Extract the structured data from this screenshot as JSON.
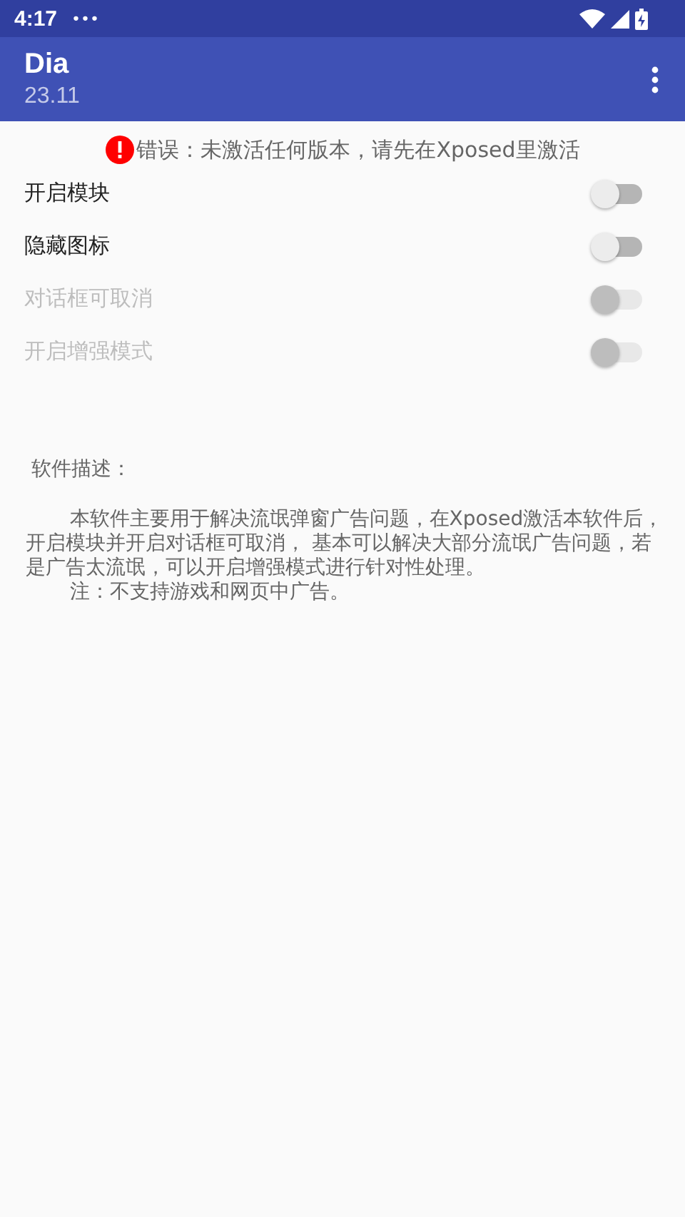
{
  "status_bar": {
    "time": "4:17",
    "notification_dots": "•••"
  },
  "app_bar": {
    "title": "Dia",
    "subtitle": "23.11"
  },
  "error": {
    "text": "错误：未激活任何版本，请先在Xposed里激活"
  },
  "settings": [
    {
      "label": "开启模块",
      "checked": false,
      "disabled": false
    },
    {
      "label": "隐藏图标",
      "checked": false,
      "disabled": false
    },
    {
      "label": "对话框可取消",
      "checked": false,
      "disabled": true
    },
    {
      "label": "开启增强模式",
      "checked": false,
      "disabled": true
    }
  ],
  "description": {
    "heading": "软件描述：",
    "paragraphs": [
      "本软件主要用于解决流氓弹窗广告问题，在Xposed激活本软件后，开启模块并开启对话框可取消， 基本可以解决大部分流氓广告问题，若是广告太流氓，可以开启增强模式进行针对性处理。",
      "注：不支持游戏和网页中广告。"
    ]
  }
}
